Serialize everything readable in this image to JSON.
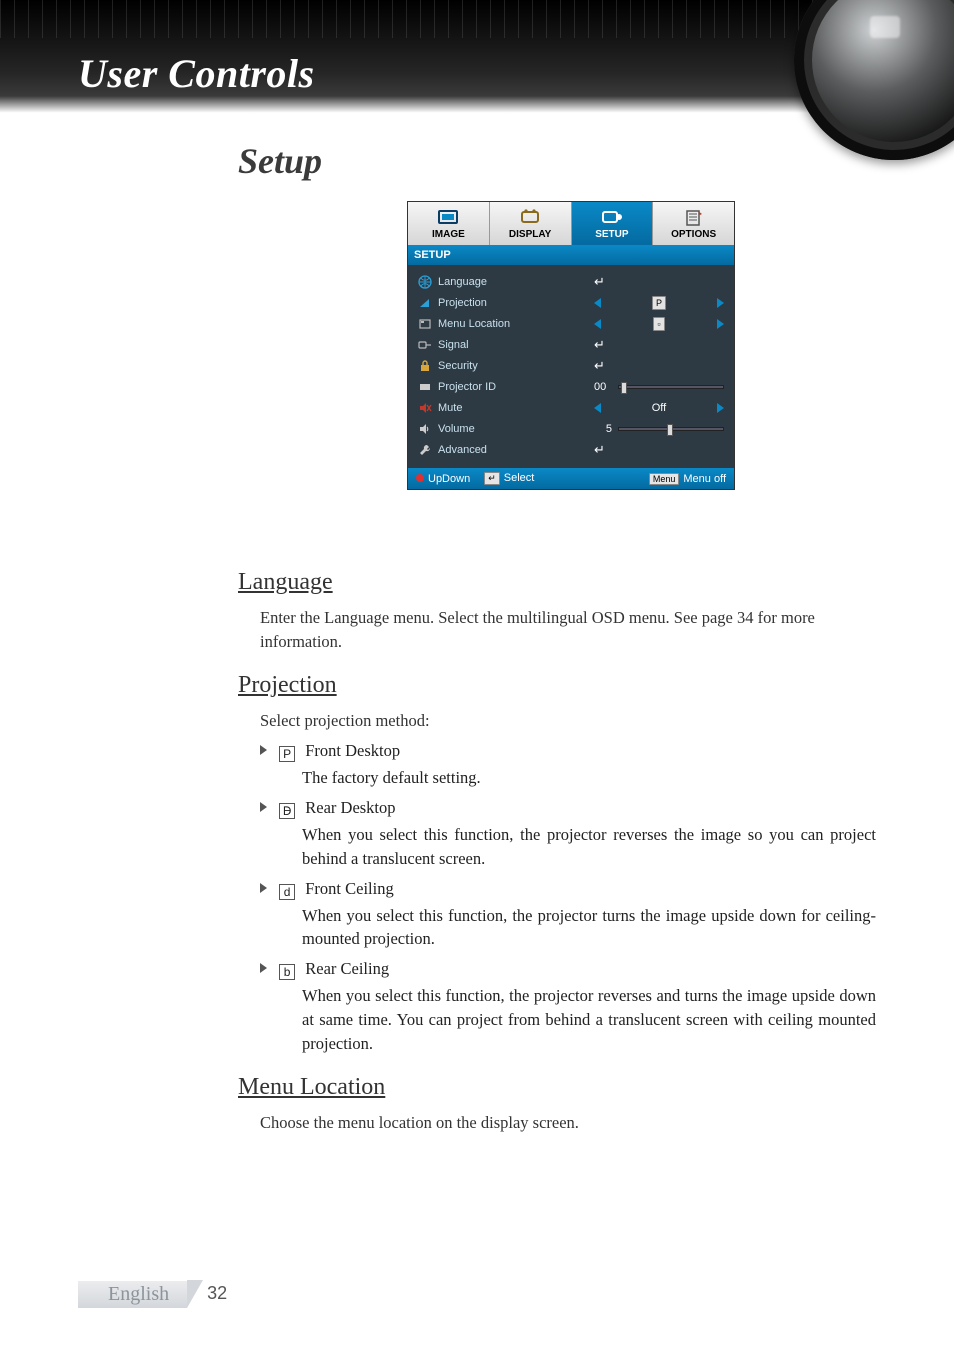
{
  "banner": {
    "title": "User Controls"
  },
  "section_title": "Setup",
  "osd": {
    "tabs": [
      {
        "label": "IMAGE",
        "active": false
      },
      {
        "label": "DISPLAY",
        "active": false
      },
      {
        "label": "SETUP",
        "active": true
      },
      {
        "label": "OPTIONS",
        "active": false
      }
    ],
    "panel_title": "SETUP",
    "rows": {
      "language": {
        "label": "Language",
        "control": "enter"
      },
      "projection": {
        "label": "Projection",
        "control": "lr-chip",
        "chip": "P"
      },
      "menu_location": {
        "label": "Menu Location",
        "control": "lr-chip",
        "chip": "▫"
      },
      "signal": {
        "label": "Signal",
        "control": "enter"
      },
      "security": {
        "label": "Security",
        "control": "enter"
      },
      "projector_id": {
        "label": "Projector ID",
        "control": "num-slider",
        "value": "00",
        "knob_pct": 2
      },
      "mute": {
        "label": "Mute",
        "control": "lr-text",
        "text": "Off"
      },
      "volume": {
        "label": "Volume",
        "control": "num-slider",
        "value": "5",
        "knob_pct": 46
      },
      "advanced": {
        "label": "Advanced",
        "control": "enter"
      }
    },
    "footer": {
      "updown": "UpDown",
      "select": "Select",
      "select_key": "↵",
      "menuoff": "Menu off",
      "menu_key": "Menu"
    }
  },
  "sections": {
    "language": {
      "heading": "Language",
      "body": "Enter the Language menu. Select the multilingual OSD menu. See page 34 for more information."
    },
    "projection": {
      "heading": "Projection",
      "lead": "Select projection method:",
      "items": [
        {
          "glyph": "P",
          "title": "Front Desktop",
          "desc": "The factory default setting."
        },
        {
          "glyph": "Ꟈ",
          "title": "Rear Desktop",
          "desc": "When you select this function, the projector reverses the image so you can project behind a translucent screen."
        },
        {
          "glyph": "d",
          "title": "Front Ceiling",
          "desc": "When you select this function, the projector turns the image upside down for ceiling-mounted projection."
        },
        {
          "glyph": "b",
          "title": "Rear Ceiling",
          "desc": "When you select this function, the projector reverses and turns the image upside down at same time. You can project from behind a translucent screen with ceiling mounted projection."
        }
      ]
    },
    "menu_location": {
      "heading": "Menu Location",
      "body": "Choose the menu location on the display screen."
    }
  },
  "footer": {
    "language": "English",
    "page_number": "32"
  }
}
